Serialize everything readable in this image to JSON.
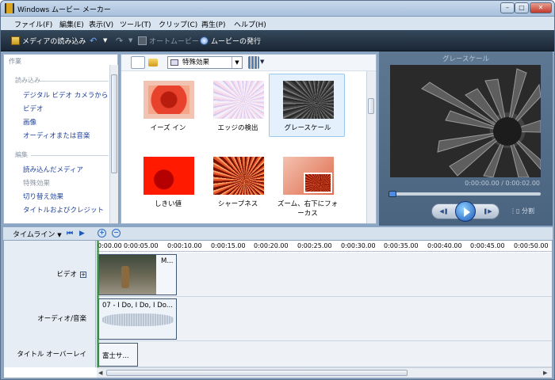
{
  "window": {
    "title": "Windows ムービー メーカー",
    "minimize": "–",
    "maximize": "□",
    "close": "✕"
  },
  "menu": [
    "ファイル(F)",
    "編集(E)",
    "表示(V)",
    "ツール(T)",
    "クリップ(C)",
    "再生(P)",
    "ヘルプ(H)"
  ],
  "toolbar": {
    "import": "メディアの読み込み",
    "auto_movie": "オートムービー",
    "publish": "ムービーの発行"
  },
  "tasks": {
    "title": "作業",
    "import_section": "読み込み",
    "import_items": [
      "デジタル ビデオ カメラから",
      "ビデオ",
      "画像",
      "オーディオまたは音楽"
    ],
    "edit_section": "編集",
    "edit_items": [
      "読み込んだメディア",
      "特殊効果",
      "切り替え効果",
      "タイトルおよびクレジット"
    ]
  },
  "effects": {
    "dropdown": "特殊効果",
    "items": [
      "イーズ イン",
      "エッジの検出",
      "グレースケール",
      "しきい値",
      "シャープネス",
      "ズーム、右下にフォーカス"
    ],
    "selected": "グレースケール"
  },
  "preview": {
    "title": "グレースケール",
    "time": "0:00:00.00 / 0:00:02.00",
    "split": "分割",
    "progress": 0
  },
  "timeline": {
    "mode": "タイムライン",
    "ticks": [
      "0:00.00",
      "0:00:05.00",
      "0:00:10.00",
      "0:00:15.00",
      "0:00:20.00",
      "0:00:25.00",
      "0:00:30.00",
      "0:00:35.00",
      "0:00:40.00",
      "0:00:45.00",
      "0:00:50.00"
    ],
    "tracks": {
      "video": "ビデオ",
      "audio": "オーディオ/音楽",
      "title": "タイトル オーバーレイ"
    },
    "clips": {
      "video": "M...",
      "audio": "07 - I Do, I Do, I Do...",
      "title": "富士サ..."
    }
  },
  "colors": {
    "toolbar": "#1b2633",
    "selection": "#e4f1fc",
    "link": "#1c3f9a"
  }
}
